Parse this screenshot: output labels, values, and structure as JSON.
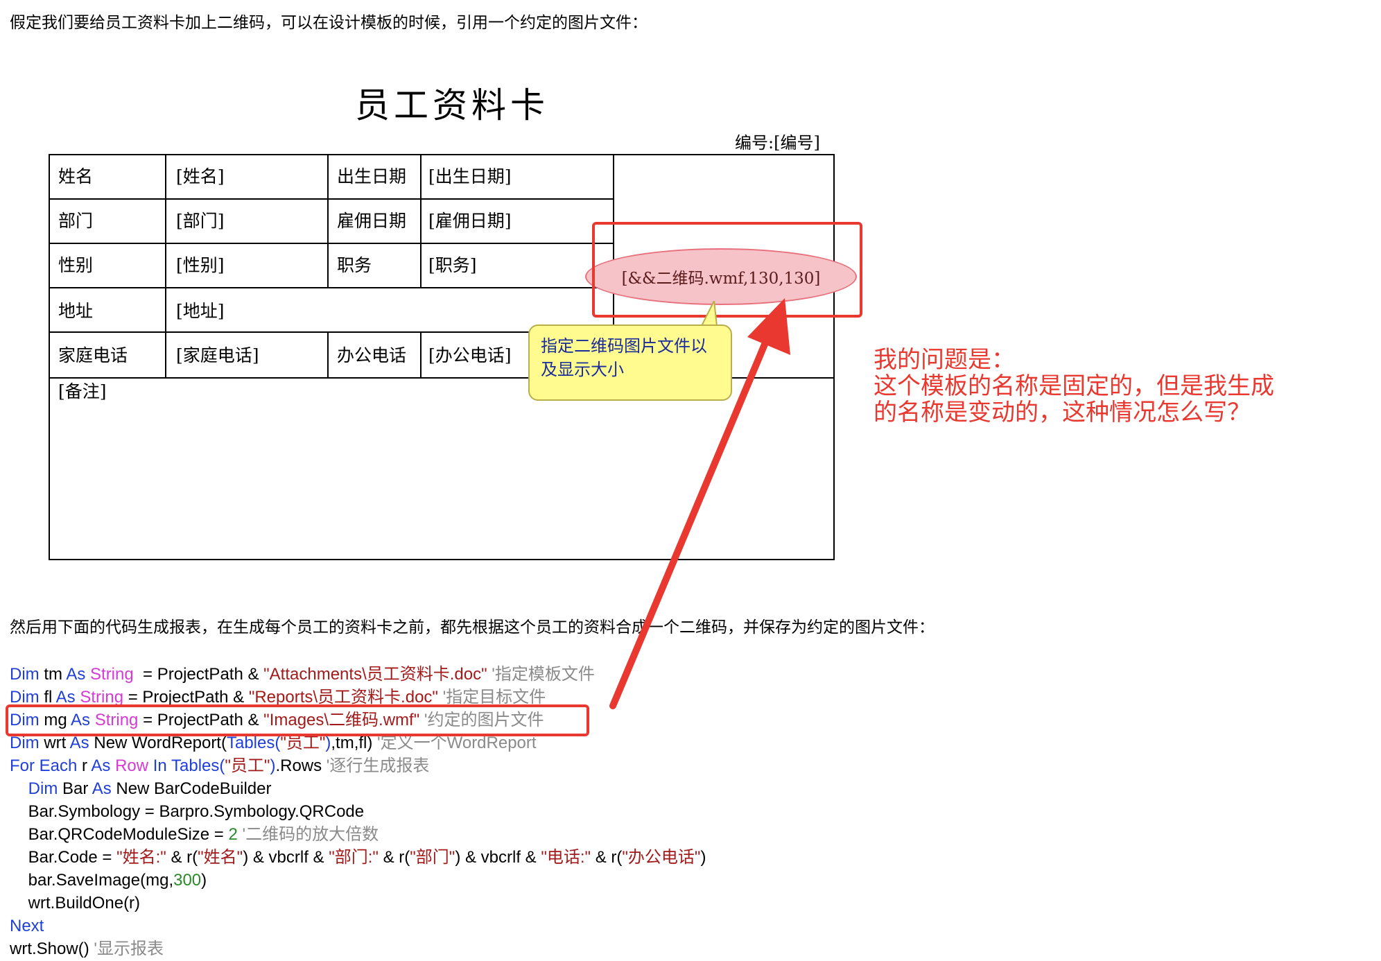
{
  "intro_text": "假定我们要给员工资料卡加上二维码，可以在设计模板的时候，引用一个约定的图片文件：",
  "card": {
    "title": "员工资料卡",
    "number_label": "编号:[编号]",
    "rows": [
      [
        "姓名",
        "[姓名]",
        "出生日期",
        "[出生日期]"
      ],
      [
        "部门",
        "[部门]",
        "雇佣日期",
        "[雇佣日期]"
      ],
      [
        "性别",
        "[性别]",
        "职务",
        "[职务]"
      ],
      [
        "地址",
        "[地址]"
      ],
      [
        "家庭电话",
        "[家庭电话]",
        "办公电话",
        "[办公电话]"
      ]
    ],
    "remark": "[备注]",
    "image_placeholder": "[&&二维码.wmf,130,130]"
  },
  "callout_text": "指定二维码图片文件以及显示大小",
  "question": {
    "line1": "我的问题是：",
    "line2": "这个模板的名称是固定的，但是我生成",
    "line3": "的名称是变动的，这种情况怎么写？"
  },
  "mid_text": "然后用下面的代码生成报表，在生成每个员工的资料卡之前，都先根据这个员工的资料合成一个二维码，并保存为约定的图片文件：",
  "code": [
    [
      [
        "kw",
        "Dim"
      ],
      [
        "tx",
        " tm "
      ],
      [
        "kw",
        "As"
      ],
      [
        "ty",
        " String"
      ],
      [
        "tx",
        "  = ProjectPath & "
      ],
      [
        "st",
        "\"Attachments\\员工资料卡.doc\""
      ],
      [
        "cm",
        " '指定模板文件"
      ]
    ],
    [
      [
        "kw",
        "Dim"
      ],
      [
        "tx",
        " fl "
      ],
      [
        "kw",
        "As"
      ],
      [
        "ty",
        " String"
      ],
      [
        "tx",
        " = ProjectPath & "
      ],
      [
        "st",
        "\"Reports\\员工资料卡.doc\""
      ],
      [
        "cm",
        " '指定目标文件"
      ]
    ],
    [
      [
        "kw",
        "Dim"
      ],
      [
        "tx",
        " mg "
      ],
      [
        "kw",
        "As"
      ],
      [
        "ty",
        " String"
      ],
      [
        "tx",
        " = ProjectPath & "
      ],
      [
        "st",
        "\"Images\\二维码.wmf\""
      ],
      [
        "cm",
        " '约定的图片文件"
      ]
    ],
    [
      [
        "kw",
        "Dim"
      ],
      [
        "tx",
        " wrt "
      ],
      [
        "kw",
        "As"
      ],
      [
        "tx",
        " New WordReport("
      ],
      [
        "kw",
        "Tables("
      ],
      [
        "st",
        "\"员工\""
      ],
      [
        "kw",
        ")"
      ],
      [
        "tx",
        ",tm,fl) "
      ],
      [
        "cm",
        "'定义一个WordReport"
      ]
    ],
    [
      [
        "kw",
        "For Each"
      ],
      [
        "tx",
        " r "
      ],
      [
        "kw",
        "As"
      ],
      [
        "ty",
        " Row"
      ],
      [
        "kw",
        " In Tables("
      ],
      [
        "st",
        "\"员工\""
      ],
      [
        "kw",
        ")"
      ],
      [
        "tx",
        ".Rows "
      ],
      [
        "cm",
        "'逐行生成报表"
      ]
    ],
    [
      [
        "tx",
        "    "
      ],
      [
        "kw",
        "Dim"
      ],
      [
        "tx",
        " Bar "
      ],
      [
        "kw",
        "As"
      ],
      [
        "tx",
        " New BarCodeBuilder"
      ]
    ],
    [
      [
        "tx",
        "    Bar.Symbology = Barpro.Symbology.QRCode"
      ]
    ],
    [
      [
        "tx",
        "    Bar.QRCodeModuleSize = "
      ],
      [
        "nm",
        "2"
      ],
      [
        "cm",
        " '二维码的放大倍数"
      ]
    ],
    [
      [
        "tx",
        "    Bar.Code = "
      ],
      [
        "st",
        "\"姓名:\""
      ],
      [
        "tx",
        " & r("
      ],
      [
        "st",
        "\"姓名\""
      ],
      [
        "tx",
        ") & vbcrlf & "
      ],
      [
        "st",
        "\"部门:\""
      ],
      [
        "tx",
        " & r("
      ],
      [
        "st",
        "\"部门\""
      ],
      [
        "tx",
        ") & vbcrlf & "
      ],
      [
        "st",
        "\"电话:\""
      ],
      [
        "tx",
        " & r("
      ],
      [
        "st",
        "\"办公电话\""
      ],
      [
        "tx",
        ")"
      ]
    ],
    [
      [
        "tx",
        "    bar.SaveImage(mg,"
      ],
      [
        "nm",
        "300"
      ],
      [
        "tx",
        ")"
      ]
    ],
    [
      [
        "tx",
        "    wrt.BuildOne(r)"
      ]
    ],
    [
      [
        "kw",
        "Next"
      ]
    ],
    [
      [
        "tx",
        "wrt.Show() "
      ],
      [
        "cm",
        "'显示报表"
      ]
    ]
  ]
}
